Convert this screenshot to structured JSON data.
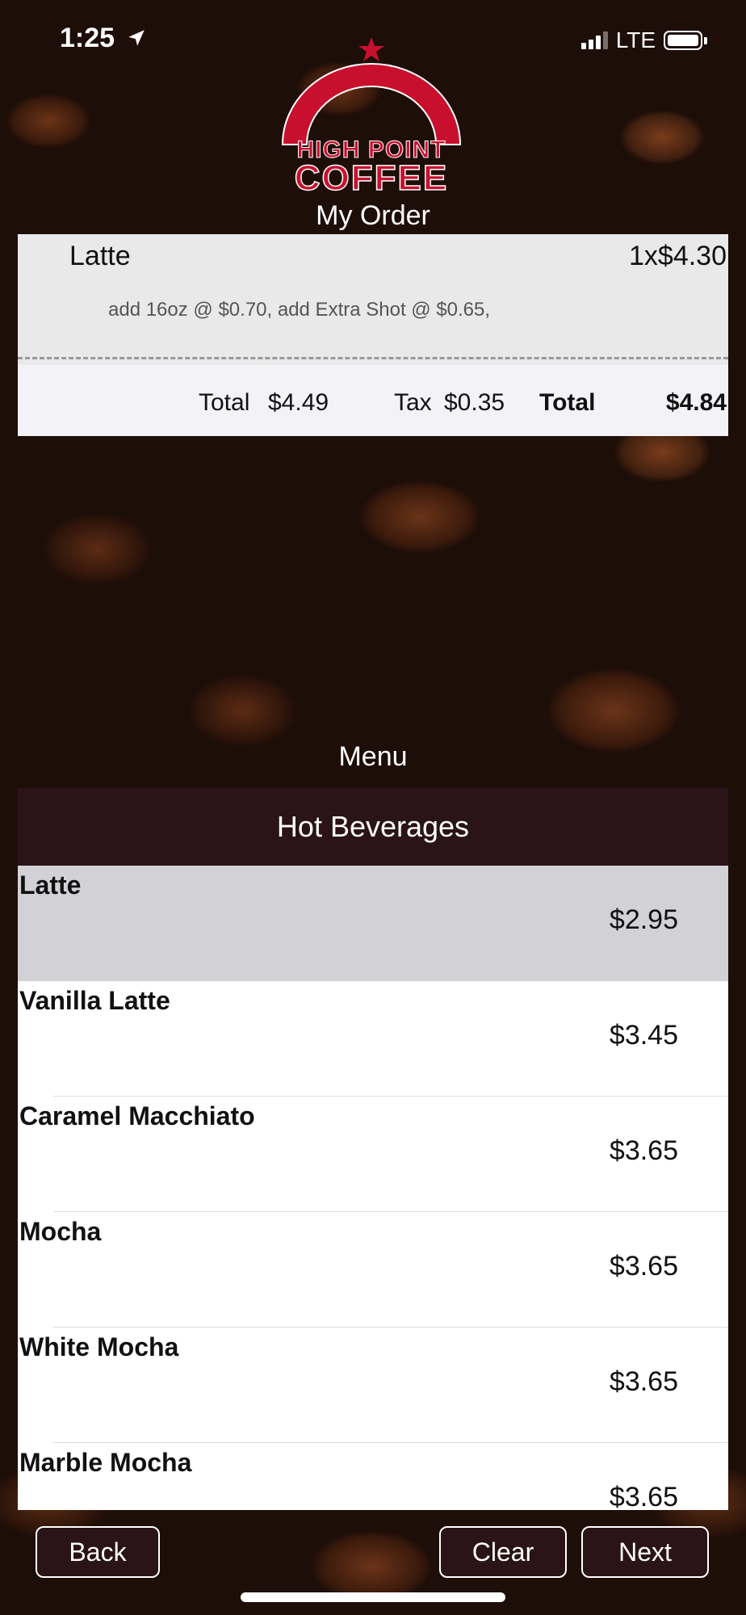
{
  "status_bar": {
    "time": "1:25",
    "network": "LTE"
  },
  "brand": {
    "line1": "HIGH POINT",
    "line2": "COFFEE"
  },
  "order": {
    "title": "My Order",
    "item": {
      "name": "Latte",
      "qty_price": "1x$4.30",
      "modifiers": "add 16oz @ $0.70, add Extra Shot @ $0.65,"
    },
    "totals": {
      "subtotal_label": "Total",
      "subtotal": "$4.49",
      "tax_label": "Tax",
      "tax": "$0.35",
      "total_label": "Total",
      "total": "$4.84"
    }
  },
  "menu": {
    "title": "Menu",
    "category": "Hot Beverages",
    "items": [
      {
        "name": "Latte",
        "price": "$2.95",
        "selected": true
      },
      {
        "name": "Vanilla Latte",
        "price": "$3.45"
      },
      {
        "name": "Caramel Macchiato",
        "price": "$3.65"
      },
      {
        "name": "Mocha",
        "price": "$3.65"
      },
      {
        "name": "White Mocha",
        "price": "$3.65"
      },
      {
        "name": "Marble Mocha",
        "price": "$3.65"
      }
    ]
  },
  "buttons": {
    "back": "Back",
    "clear": "Clear",
    "next": "Next"
  },
  "colors": {
    "brand_red": "#c8102e",
    "dark_header": "#2a1418",
    "selected_row": "#d1d1d6"
  }
}
